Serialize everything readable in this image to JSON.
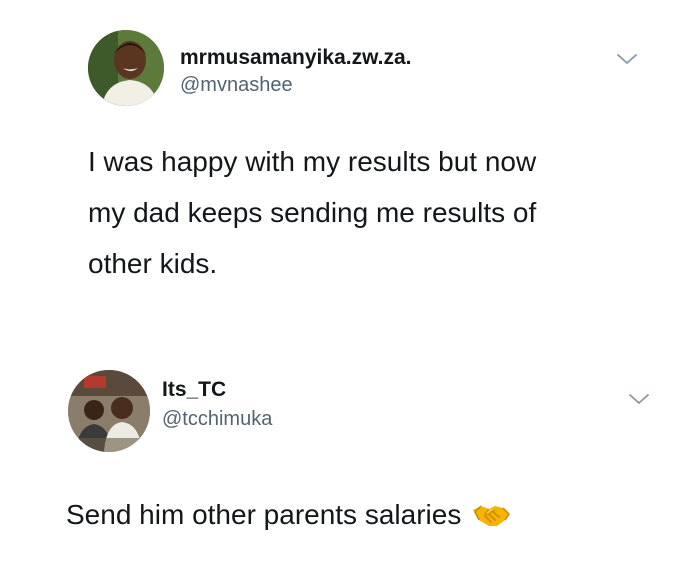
{
  "tweets": [
    {
      "display_name": "mrmusamanyika.zw.za.",
      "handle": "@mvnashee",
      "text_lines": [
        "I was happy with my results but now",
        "my dad keeps sending me results of",
        "other kids."
      ],
      "menu_icon": "chevron-down-icon"
    },
    {
      "display_name": "Its_TC",
      "handle": "@tcchimuka",
      "text": "Send him other parents salaries",
      "emoji_icon": "handshake-icon",
      "menu_icon": "chevron-down-icon"
    }
  ],
  "colors": {
    "text": "#14171a",
    "handle": "#536471",
    "chevron": "#8899a6",
    "handshake": "#f4b400"
  }
}
